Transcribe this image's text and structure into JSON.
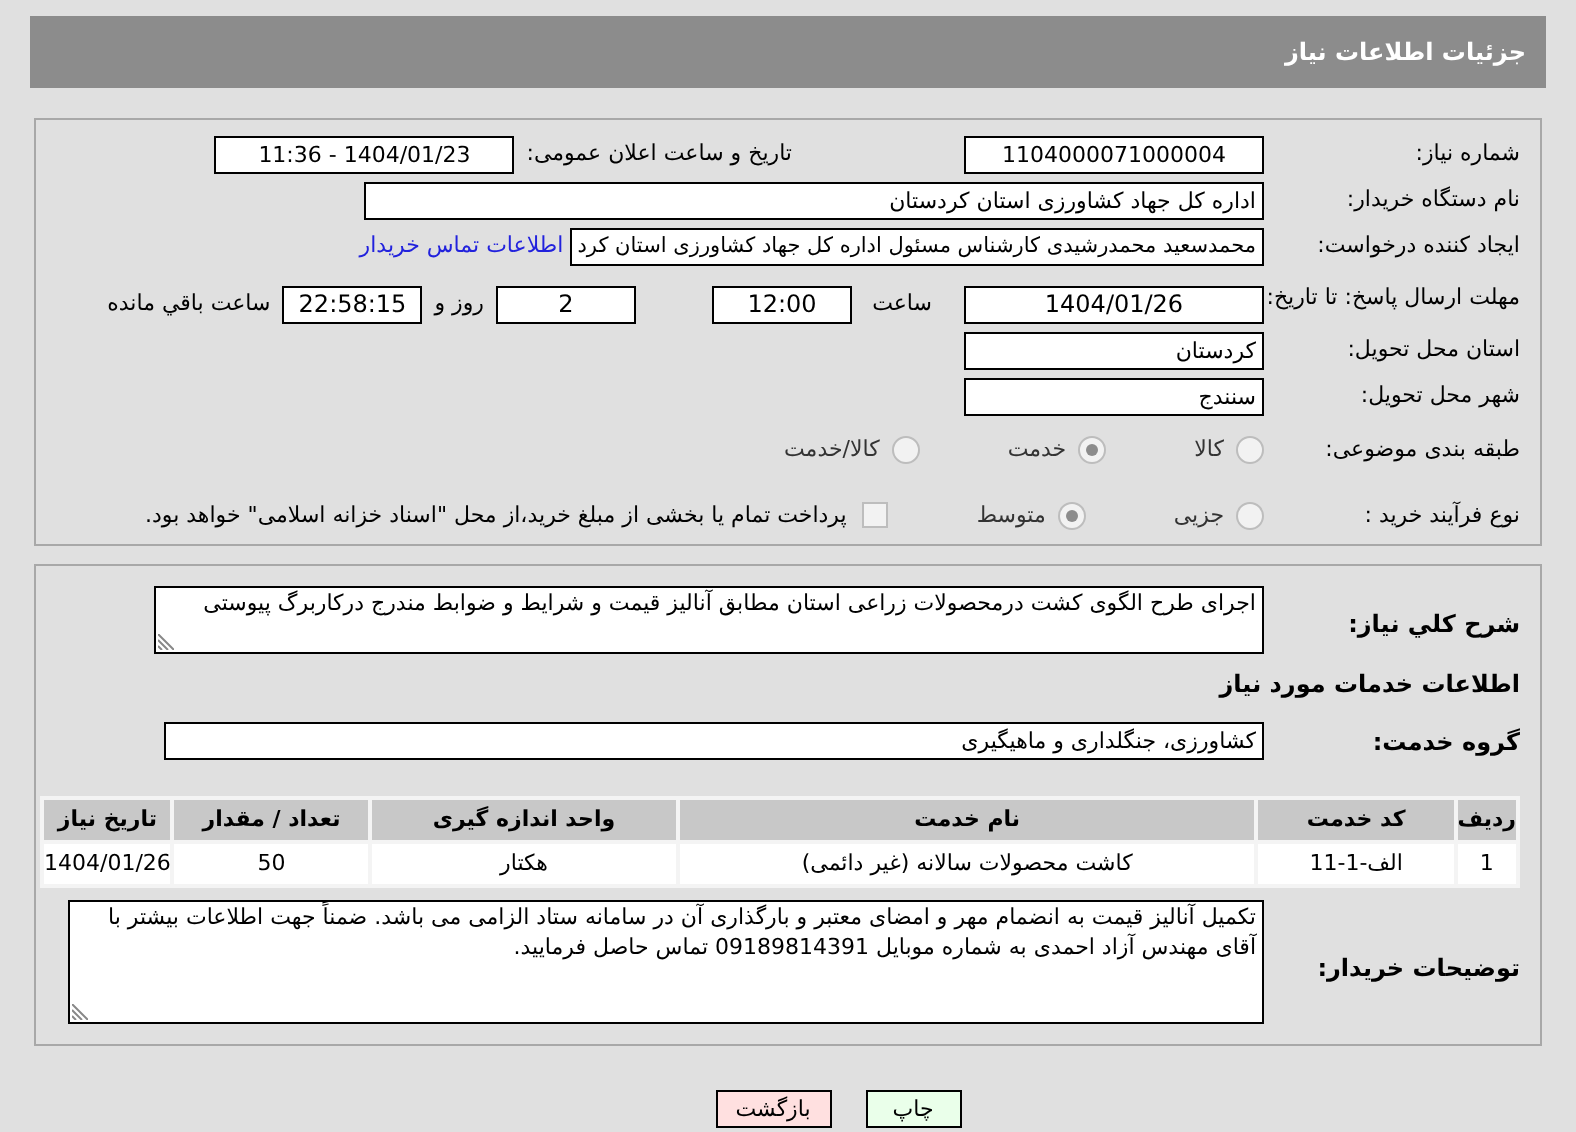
{
  "header": {
    "title": "جزئیات اطلاعات نیاز"
  },
  "details": {
    "need_number": {
      "label": "شماره نیاز:",
      "value": "1104000071000004"
    },
    "announce": {
      "label": "تاریخ و ساعت اعلان عمومی:",
      "value": "1404/01/23 - 11:36"
    },
    "buyer": {
      "label": "نام دستگاه خریدار:",
      "value": "اداره کل جهاد کشاورزی استان کردستان"
    },
    "creator": {
      "label": "ایجاد کننده درخواست:",
      "value": "محمدسعید محمدرشیدی کارشناس مسئول اداره کل جهاد کشاورزی استان کرد",
      "link": "اطلاعات تماس خریدار"
    },
    "deadline": {
      "label": "مهلت ارسال پاسخ: تا تاریخ:",
      "date": "1404/01/26",
      "time_label": "ساعت",
      "time": "12:00",
      "days": "2",
      "days_label": "روز و",
      "remaining": "22:58:15",
      "remaining_label": "ساعت باقي مانده"
    },
    "province": {
      "label": "استان محل تحویل:",
      "value": "کردستان"
    },
    "city": {
      "label": "شهر محل تحویل:",
      "value": "سنندج"
    },
    "category": {
      "label": "طبقه بندی موضوعی:",
      "options": [
        {
          "label": "کالا",
          "selected": false
        },
        {
          "label": "خدمت",
          "selected": true
        },
        {
          "label": "کالا/خدمت",
          "selected": false
        }
      ]
    },
    "process": {
      "label": "نوع فرآیند خرید :",
      "options": [
        {
          "label": "جزیی",
          "selected": false
        },
        {
          "label": "متوسط",
          "selected": true
        }
      ],
      "treasury": {
        "label": "پرداخت تمام یا بخشی از مبلغ خرید،از محل \"اسناد خزانه اسلامی\" خواهد بود.",
        "checked": false
      }
    }
  },
  "services": {
    "description": {
      "label": "شرح کلي نیاز:",
      "value": "اجرای طرح الگوی کشت درمحصولات زراعی استان مطابق آنالیز قیمت و شرایط و ضوابط مندرج درکاربرگ پیوستی"
    },
    "heading": "اطلاعات خدمات مورد نیاز",
    "group": {
      "label": "گروه خدمت:",
      "value": "کشاورزی، جنگلداری و ماهیگیری"
    },
    "table": {
      "columns": [
        "ردیف",
        "کد خدمت",
        "نام خدمت",
        "واحد اندازه گیری",
        "تعداد / مقدار",
        "تاریخ نیاز"
      ],
      "rows": [
        [
          "1",
          "الف-1-11",
          "کاشت محصولات سالانه (غیر دائمی)",
          "هکتار",
          "50",
          "1404/01/26"
        ]
      ]
    },
    "notes": {
      "label": "توضیحات خریدار:",
      "value": "تکمیل آنالیز قیمت به انضمام مهر و امضای معتبر و بارگذاری آن در سامانه ستاد الزامی می باشد. ضمناً جهت اطلاعات بیشتر با آقای مهندس آزاد احمدی  به شماره موبایل  09189814391 تماس حاصل فرمایید."
    }
  },
  "buttons": [
    {
      "label": "چاپ",
      "kind": "print"
    },
    {
      "label": "بازگشت",
      "kind": "back"
    }
  ]
}
